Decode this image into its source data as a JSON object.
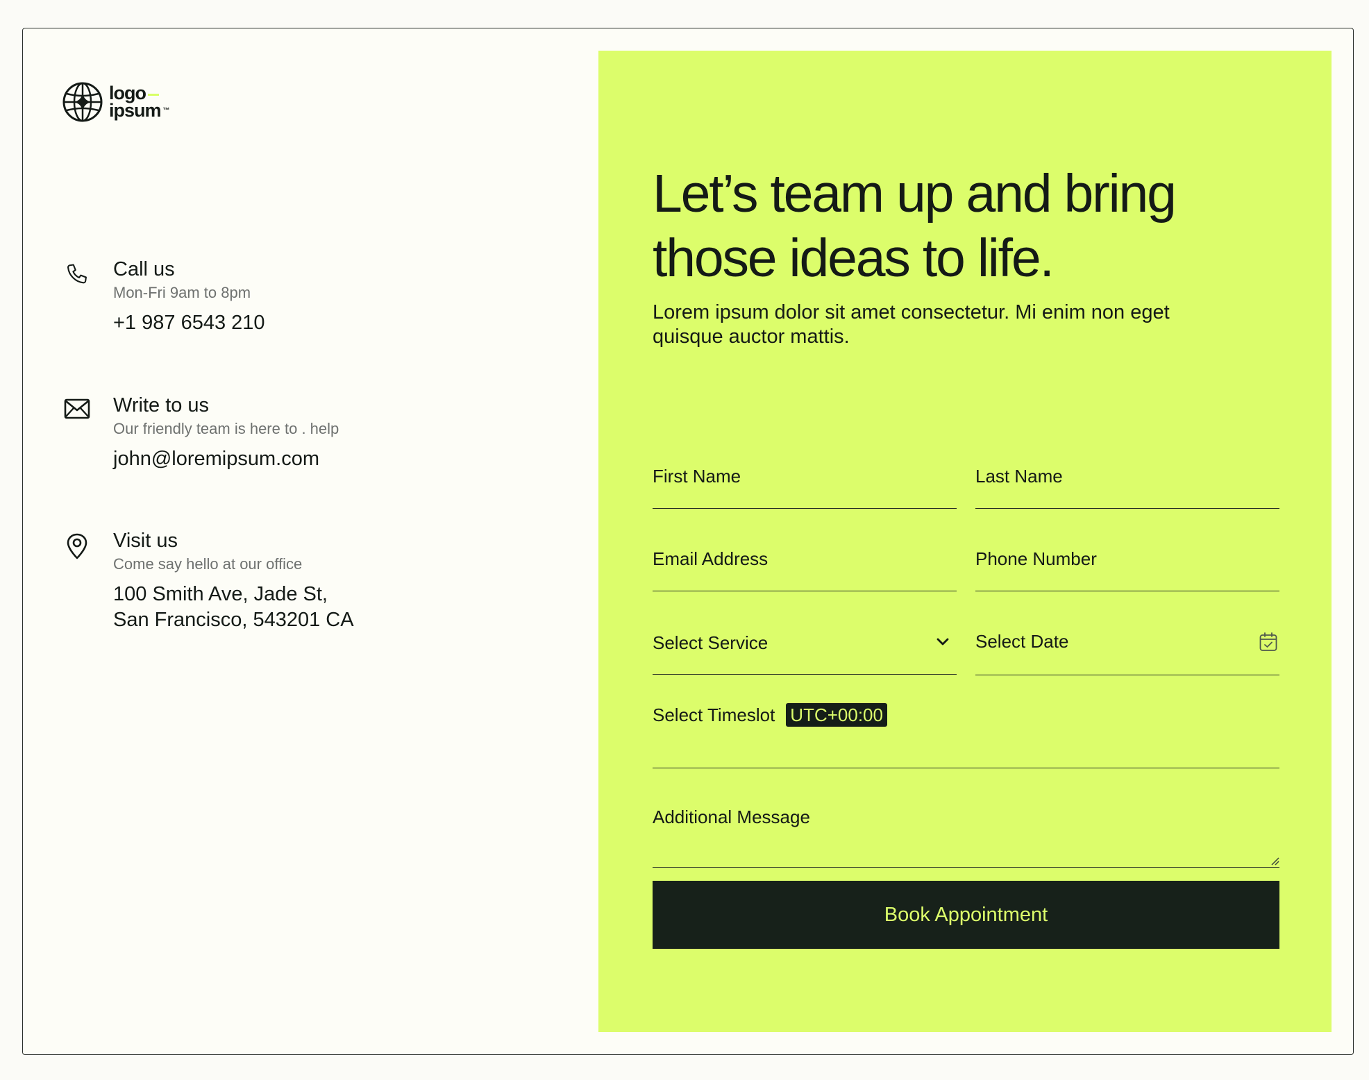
{
  "brand": {
    "logo_line1": "logo",
    "logo_line2": "ipsum",
    "logo_tm": "™",
    "accent_color": "#dcfd6b",
    "dark_color": "#17211a"
  },
  "contacts": [
    {
      "icon": "phone-icon",
      "title": "Call us",
      "subtitle": "Mon-Fri 9am to 8pm",
      "value": "+1 987 6543 210"
    },
    {
      "icon": "envelope-icon",
      "title": "Write to us",
      "subtitle": "Our friendly team is here to . help",
      "value": "john@loremipsum.com"
    },
    {
      "icon": "map-pin-icon",
      "title": "Visit us",
      "subtitle": "Come say hello at our office",
      "value_line1": "100 Smith Ave, Jade St,",
      "value_line2": "San Francisco, 543201 CA"
    }
  ],
  "form": {
    "heading_line1": "Let’s team up and bring",
    "heading_line2": "those ideas to life.",
    "lead_line1": "Lorem ipsum dolor sit amet consectetur. Mi enim non eget",
    "lead_line2": "quisque auctor mattis.",
    "first_name_label": "First Name",
    "last_name_label": "Last Name",
    "email_label": "Email Address",
    "phone_label": "Phone Number",
    "service_label": "Select Service",
    "date_label": "Select Date",
    "timeslot_label": "Select Timeslot",
    "timezone": "UTC+00:00",
    "message_label": "Additional Message",
    "submit_label": "Book Appointment"
  }
}
